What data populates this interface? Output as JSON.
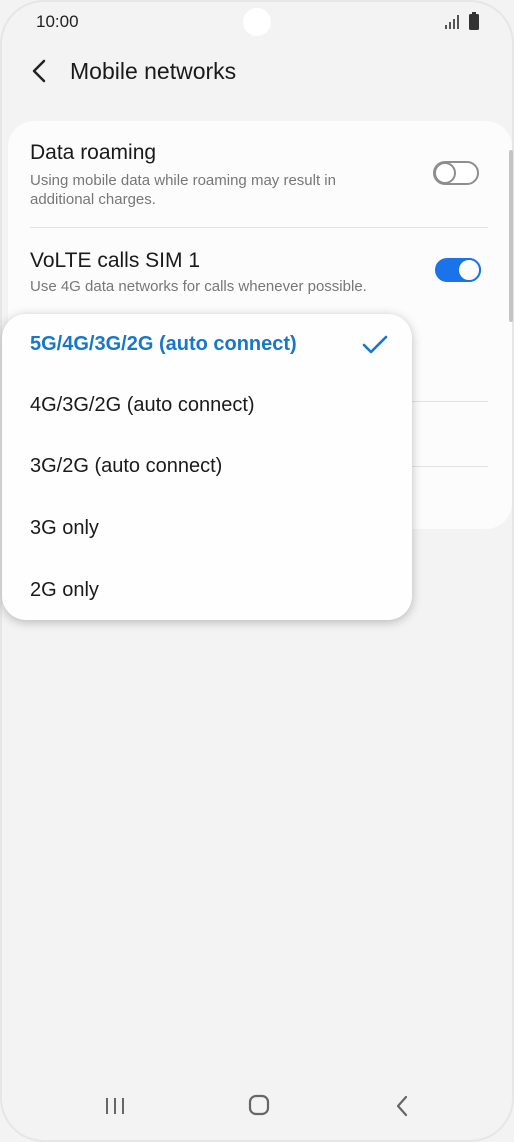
{
  "status_bar": {
    "time": "10:00"
  },
  "header": {
    "title": "Mobile networks"
  },
  "settings": [
    {
      "title": "Data roaming",
      "description": "Using mobile data while roaming may result in additional charges.",
      "toggle_on": false
    },
    {
      "title": "VoLTE calls SIM 1",
      "description": "Use 4G data networks for calls whenever possible.",
      "toggle_on": true
    }
  ],
  "network_mode_menu": {
    "options": [
      {
        "label": "5G/4G/3G/2G (auto connect)",
        "selected": true
      },
      {
        "label": "4G/3G/2G (auto connect)",
        "selected": false
      },
      {
        "label": "3G/2G (auto connect)",
        "selected": false
      },
      {
        "label": "3G only",
        "selected": false
      },
      {
        "label": "2G only",
        "selected": false
      }
    ]
  },
  "colors": {
    "accent": "#1a73e8",
    "selected_text": "#1877c9",
    "background": "#f3f3f3"
  },
  "icons": [
    "signal-icon",
    "battery-icon",
    "back-arrow-icon",
    "check-icon",
    "nav-recents-icon",
    "nav-home-icon",
    "nav-back-icon"
  ]
}
